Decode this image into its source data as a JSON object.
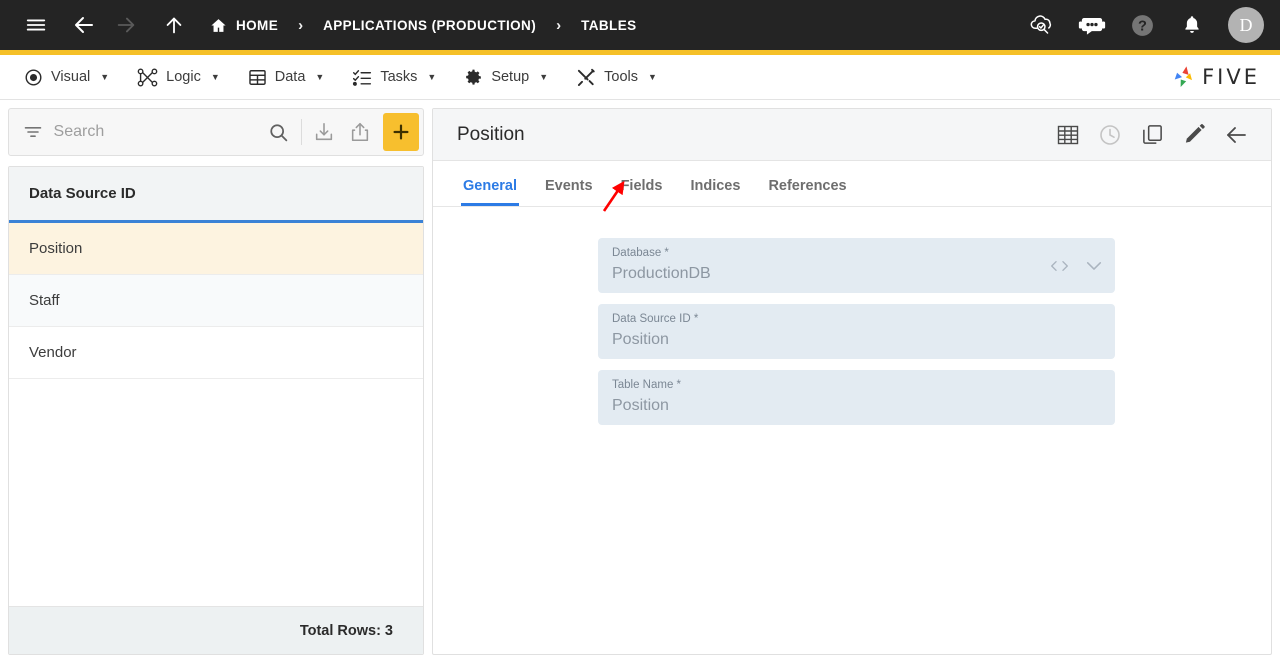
{
  "topbar": {
    "menu_icon": "hamburger-icon",
    "back_icon": "arrow-left-icon",
    "forward_icon": "arrow-right-icon",
    "up_icon": "arrow-up-icon",
    "breadcrumb": [
      {
        "label": "HOME",
        "icon": "home-icon"
      },
      {
        "label": "APPLICATIONS (PRODUCTION)",
        "icon": ""
      },
      {
        "label": "TABLES",
        "icon": ""
      }
    ],
    "separator": "›",
    "actions": [
      {
        "name": "cloud-check-search-icon"
      },
      {
        "name": "robot-chat-icon"
      },
      {
        "name": "help-icon"
      },
      {
        "name": "bell-icon"
      }
    ],
    "avatar_initial": "D",
    "accent_color": "#f5c028"
  },
  "menubar": {
    "items": [
      {
        "label": "Visual",
        "icon": "eye-icon",
        "caret": "▼"
      },
      {
        "label": "Logic",
        "icon": "logic-nodes-icon",
        "caret": "▼"
      },
      {
        "label": "Data",
        "icon": "grid-table-icon",
        "caret": "▼"
      },
      {
        "label": "Tasks",
        "icon": "checklist-icon",
        "caret": "▼"
      },
      {
        "label": "Setup",
        "icon": "gear-icon",
        "caret": "▼"
      },
      {
        "label": "Tools",
        "icon": "tools-icon",
        "caret": "▼"
      }
    ],
    "logo_text": "FIVE",
    "logo_colors": [
      "#ea4335",
      "#fbbc04",
      "#34a853",
      "#4285f4"
    ]
  },
  "left_panel": {
    "search": {
      "placeholder": "Search",
      "value": "",
      "filter_icon": "filter-icon",
      "search_icon": "search-icon",
      "import_icon": "import-download-icon",
      "export_icon": "export-share-icon",
      "add_label": "+",
      "add_color": "#f7bf2e"
    },
    "grid": {
      "columns": [
        "Data Source ID"
      ],
      "rows": [
        {
          "data_source_id": "Position",
          "selected": true
        },
        {
          "data_source_id": "Staff",
          "selected": false
        },
        {
          "data_source_id": "Vendor",
          "selected": false
        }
      ],
      "footer": "Total Rows: 3",
      "header_underline_color": "#3b82d6",
      "selected_row_color": "#fdf3e0"
    }
  },
  "right_panel": {
    "title": "Position",
    "actions": [
      {
        "name": "table-grid-icon",
        "disabled": false
      },
      {
        "name": "clock-history-icon",
        "disabled": true
      },
      {
        "name": "copy-icon",
        "disabled": false
      },
      {
        "name": "edit-pencil-icon",
        "disabled": false
      },
      {
        "name": "back-arrow-icon",
        "disabled": false
      }
    ],
    "tabs": [
      {
        "label": "General",
        "active": true
      },
      {
        "label": "Events",
        "active": false
      },
      {
        "label": "Fields",
        "active": false
      },
      {
        "label": "Indices",
        "active": false
      },
      {
        "label": "References",
        "active": false
      }
    ],
    "active_tab_color": "#2c7be5",
    "fields": [
      {
        "label": "Database *",
        "value": "ProductionDB",
        "icons": [
          "code-brackets-icon",
          "chevron-down-icon"
        ]
      },
      {
        "label": "Data Source ID *",
        "value": "Position",
        "icons": []
      },
      {
        "label": "Table Name *",
        "value": "Position",
        "icons": []
      }
    ]
  },
  "annotation": {
    "arrow_color": "#ff0000",
    "points_to": "Fields"
  }
}
